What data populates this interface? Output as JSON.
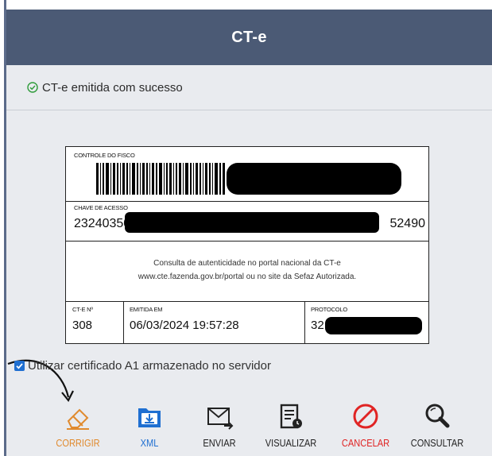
{
  "header": {
    "title": "CT-e"
  },
  "status": {
    "message": "CT-e emitida com sucesso",
    "icon": "check-circle-icon",
    "icon_color": "#2e9b3a"
  },
  "document": {
    "fisco_label": "CONTROLE DO FISCO",
    "chave_label": "CHAVE DE ACESSO",
    "chave_start": "23240350",
    "chave_end": "52490",
    "consulta_line1": "Consulta de autenticidade no portal nacional da CT-e",
    "consulta_line2": "www.cte.fazenda.gov.br/portal ou no site da Sefaz Autorizada.",
    "cte_label": "CT-E Nº",
    "cte_value": "308",
    "emitida_label": "EMITIDA EM",
    "emitida_value": "06/03/2024 19:57:28",
    "protocolo_label": "PROTOCOLO",
    "protocolo_value": "32"
  },
  "certificate": {
    "label": "Utilizar certificado A1 armazenado no servidor",
    "checked": true
  },
  "toolbar": {
    "items": [
      {
        "label": "CORRIGIR",
        "icon": "eraser-icon",
        "color": "#e08a2e"
      },
      {
        "label": "XML",
        "icon": "download-folder-icon",
        "color": "#1f6fd1"
      },
      {
        "label": "ENVIAR",
        "icon": "envelope-icon",
        "color": "#222222"
      },
      {
        "label": "VISUALIZAR",
        "icon": "document-view-icon",
        "color": "#222222"
      },
      {
        "label": "CANCELAR",
        "icon": "cancel-icon",
        "color": "#e02424"
      },
      {
        "label": "CONSULTAR",
        "icon": "magnifier-icon",
        "color": "#222222"
      }
    ]
  }
}
